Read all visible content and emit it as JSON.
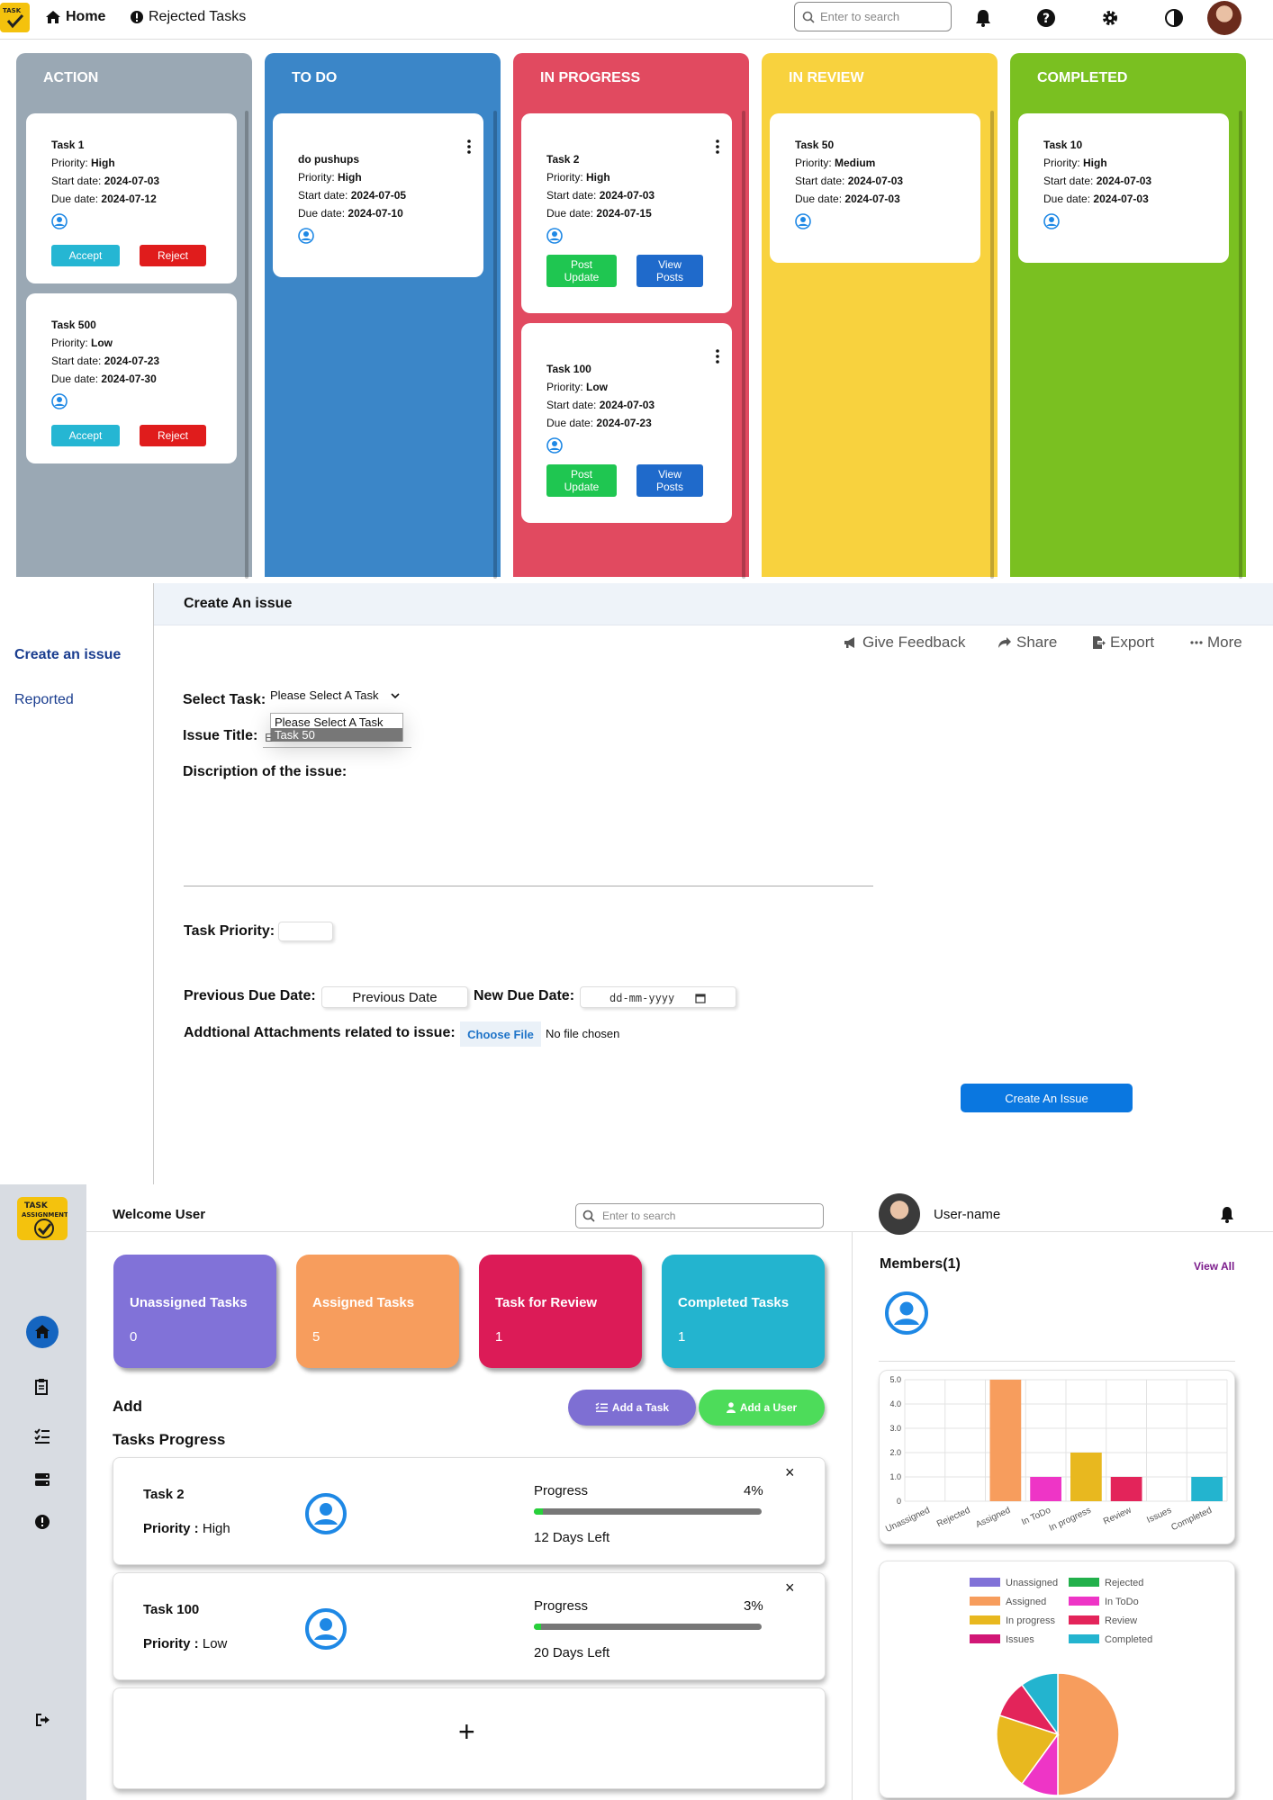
{
  "kanban": {
    "nav": {
      "home": "Home",
      "rejected": "Rejected Tasks"
    },
    "search_placeholder": "Enter to search",
    "columns": [
      {
        "title": "ACTION",
        "color": "#9aa8b4"
      },
      {
        "title": "TO DO",
        "color": "#3b86c8"
      },
      {
        "title": "IN PROGRESS",
        "color": "#e14a60"
      },
      {
        "title": "IN REVIEW",
        "color": "#f8d23e"
      },
      {
        "title": "COMPLETED",
        "color": "#7ac021"
      }
    ],
    "labels": {
      "priority": "Priority:",
      "start": "Start date:",
      "due": "Due date:"
    },
    "buttons": {
      "accept": "Accept",
      "reject": "Reject",
      "post1": "Post",
      "post2": "Update",
      "view1": "View",
      "view2": "Posts"
    },
    "cards": {
      "action": [
        {
          "title": "Task 1",
          "priority": "High",
          "start": "2024-07-03",
          "due": "2024-07-12"
        },
        {
          "title": "Task 500",
          "priority": "Low",
          "start": "2024-07-23",
          "due": "2024-07-30"
        }
      ],
      "todo": [
        {
          "title": "do pushups",
          "priority": "High",
          "start": "2024-07-05",
          "due": "2024-07-10"
        }
      ],
      "progress": [
        {
          "title": "Task 2",
          "priority": "High",
          "start": "2024-07-03",
          "due": "2024-07-15"
        },
        {
          "title": "Task 100",
          "priority": "Low",
          "start": "2024-07-03",
          "due": "2024-07-23"
        }
      ],
      "review": [
        {
          "title": "Task 50",
          "priority": "Medium",
          "start": "2024-07-03",
          "due": "2024-07-03"
        }
      ],
      "completed": [
        {
          "title": "Task 10",
          "priority": "High",
          "start": "2024-07-03",
          "due": "2024-07-03"
        }
      ]
    }
  },
  "issue": {
    "header_title": "Create An issue",
    "sidebar": {
      "create": "Create an issue",
      "reported": "Reported"
    },
    "toolbar": {
      "feedback": "Give Feedback",
      "share": "Share",
      "export": "Export",
      "more": "More"
    },
    "form": {
      "select_task_label": "Select Task:",
      "select_value": "Please Select A Task",
      "dropdown_options": [
        "Please Select A Task",
        "Task 50"
      ],
      "title_label": "Issue Title:",
      "title_partial": "E",
      "description_label": "Discription of the issue:",
      "priority_label": "Task Priority:",
      "prev_due_label": "Previous Due Date:",
      "prev_due_value": "Previous Date",
      "new_due_label": "New Due Date:",
      "new_due_placeholder": "dd-mm-yyyy",
      "attachments_label": "Addtional Attachments related to issue:",
      "choose_file": "Choose File",
      "no_file": "No file chosen",
      "submit": "Create An Issue"
    }
  },
  "dashboard": {
    "welcome": "Welcome User",
    "search_placeholder": "Enter to search",
    "username": "User-name",
    "stats": [
      {
        "label": "Unassigned Tasks",
        "value": "0",
        "color": "#8172d8"
      },
      {
        "label": "Assigned Tasks",
        "value": "5",
        "color": "#f79d5d"
      },
      {
        "label": "Task for Review",
        "value": "1",
        "color": "#dc1b57"
      },
      {
        "label": "Completed Tasks",
        "value": "1",
        "color": "#23b4cf"
      }
    ],
    "add_heading": "Add",
    "add_task": "Add a Task",
    "add_user": "Add a User",
    "progress_heading": "Tasks Progress",
    "priority_label": "Priority :",
    "progress_label": "Progress",
    "tasks": [
      {
        "name": "Task 2",
        "priority": "High",
        "percent": "4%",
        "progress": 0.04,
        "days": "12 Days Left"
      },
      {
        "name": "Task 100",
        "priority": "Low",
        "percent": "3%",
        "progress": 0.03,
        "days": "20 Days Left"
      }
    ],
    "add_symbol": "+",
    "close_symbol": "×",
    "members_heading": "Members(1)",
    "view_all": "View All"
  },
  "chart_data": [
    {
      "type": "bar",
      "categories": [
        "Unassigned",
        "Rejected",
        "Assigned",
        "In ToDo",
        "In progress",
        "Review",
        "Issues",
        "Completed"
      ],
      "values": [
        0,
        0,
        5,
        1,
        2,
        1,
        0,
        1
      ],
      "colors": [
        "#8172d8",
        "#22b04b",
        "#f79d5d",
        "#ee35c6",
        "#e8b81f",
        "#e3245a",
        "#d11776",
        "#23b4cf"
      ],
      "ylim": [
        0,
        5
      ],
      "yticks": [
        "0",
        "1.0",
        "2.0",
        "3.0",
        "4.0",
        "5.0"
      ],
      "grid": true
    },
    {
      "type": "pie",
      "categories": [
        "Unassigned",
        "Rejected",
        "Assigned",
        "In ToDo",
        "In progress",
        "Review",
        "Issues",
        "Completed"
      ],
      "values": [
        0,
        0,
        5,
        1,
        2,
        1,
        0,
        1
      ],
      "colors": [
        "#8172d8",
        "#22b04b",
        "#f79d5d",
        "#ee35c6",
        "#e8b81f",
        "#e3245a",
        "#d11776",
        "#23b4cf"
      ],
      "legend": "top"
    }
  ]
}
